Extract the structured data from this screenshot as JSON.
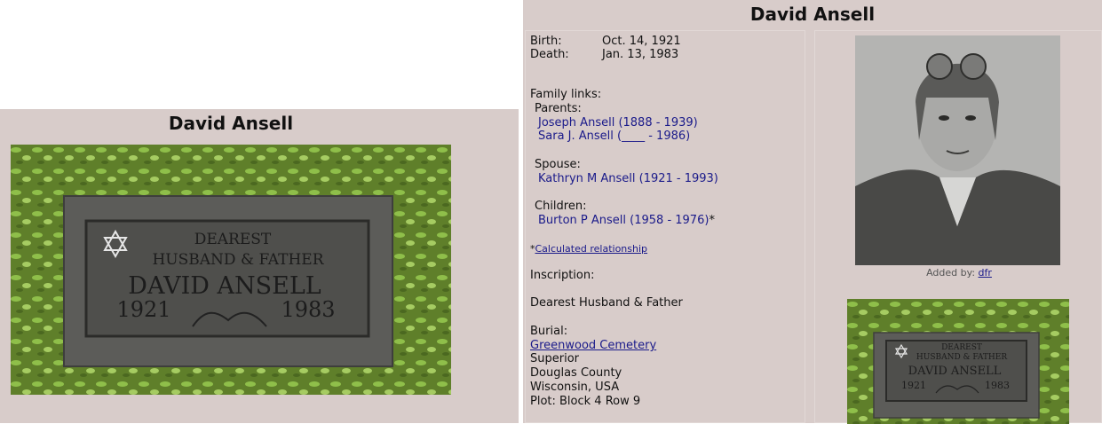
{
  "left": {
    "title": "David Ansell",
    "headstone": {
      "line1": "DEAREST",
      "line2": "HUSBAND & FATHER",
      "name": "DAVID ANSELL",
      "year_born": "1921",
      "year_died": "1983"
    }
  },
  "right": {
    "title": "David Ansell",
    "birth_label": "Birth:",
    "birth_value": "Oct. 14, 1921",
    "death_label": "Death:",
    "death_value": "Jan. 13, 1983",
    "family_links_label": "Family links:",
    "parents_label": "Parents:",
    "parents": [
      "Joseph Ansell (1888 - 1939)",
      "Sara J. Ansell (____ - 1986)"
    ],
    "spouse_label": "Spouse:",
    "spouse": "Kathryn M Ansell (1921 - 1993)",
    "children_label": "Children:",
    "child": "Burton P Ansell (1958 - 1976)",
    "child_marker": "*",
    "calc_marker": "*",
    "calc_link": "Calculated relationship",
    "inscription_label": "Inscription:",
    "inscription_text": "Dearest Husband & Father",
    "burial_label": "Burial:",
    "cemetery_link": "Greenwood Cemetery",
    "city": "Superior",
    "county": "Douglas County",
    "state": "Wisconsin, USA",
    "plot": "Plot: Block 4 Row 9",
    "added_by_label": "Added by:",
    "added_by_user": "dfr"
  },
  "colors": {
    "panel_bg": "#d8ccca",
    "link": "#1a1a8a",
    "stone": "#5b5b58",
    "grass": "#6a8a2e"
  },
  "icons": {
    "star": "star-of-david-icon"
  }
}
